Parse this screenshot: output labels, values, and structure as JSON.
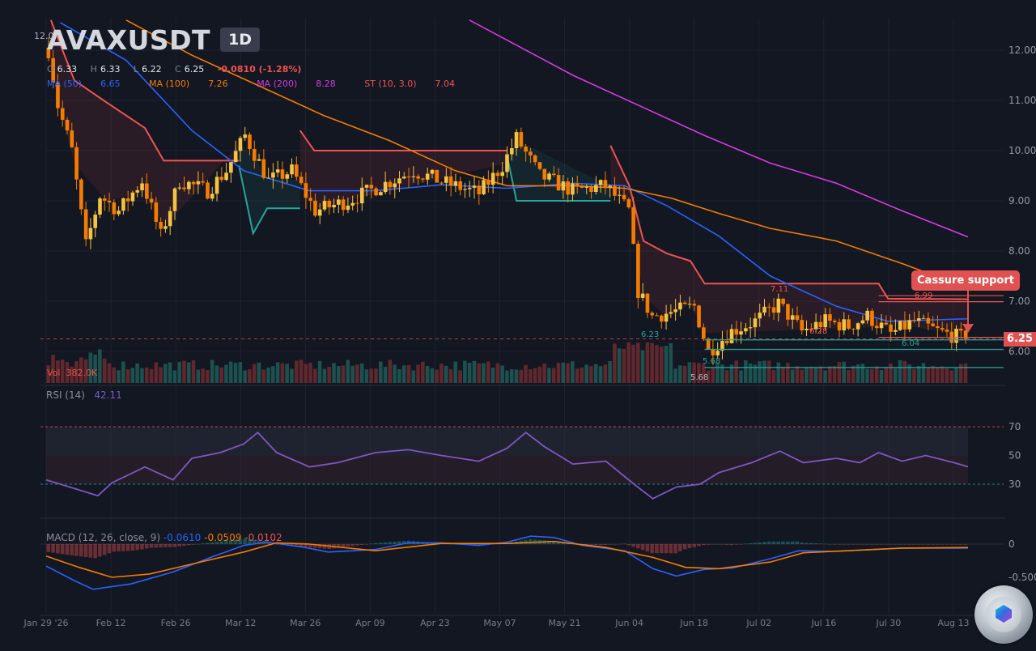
{
  "header": {
    "symbol": "AVAXUSDT",
    "timeframe": "1D",
    "ohlc": {
      "o_label": "O",
      "o": "6.33",
      "h_label": "H",
      "h": "6.33",
      "l_label": "L",
      "l": "6.22",
      "c_label": "C",
      "c": "6.25",
      "change": "-0.0810 (-1.28%)"
    },
    "mas": [
      {
        "label": "MA (50)",
        "value": "6.65",
        "color": "#2962ff"
      },
      {
        "label": "MA (100)",
        "value": "7.26",
        "color": "#f57c00"
      },
      {
        "label": "MA (200)",
        "value": "8.28",
        "color": "#d63ae0"
      },
      {
        "label": "ST (10, 3.0)",
        "value": "7.04",
        "color": "#ef5350"
      }
    ]
  },
  "callout": "Cassure support",
  "last_price_tag": "6.25",
  "top_left_tick": "12.0",
  "volume_label": "Vol",
  "volume_value": "382.0K",
  "rsi_label": "RSI (14)",
  "rsi_value": "42.11",
  "macd_label": "MACD (12, 26, close, 9)",
  "macd_values": [
    "-0.0610",
    "-0.0509",
    "-0.0102"
  ],
  "level_labels": [
    {
      "text": "7.11",
      "color": "#ef5350"
    },
    {
      "text": "6.99",
      "color": "#ef5350"
    },
    {
      "text": "6.28",
      "color": "#ef5350"
    },
    {
      "text": "6.23",
      "color": "#26a69a"
    },
    {
      "text": "6.04",
      "color": "#26a69a"
    },
    {
      "text": "5.68",
      "color": "#26a69a"
    },
    {
      "text": "5.68",
      "color": "#b0b3bf"
    }
  ],
  "colors": {
    "background": "#131722",
    "grid": "#1e2230",
    "bull": "#f5c242",
    "bear": "#f57c00",
    "vol_up": "#1f5c57",
    "vol_down": "#6e2a2f",
    "ma50": "#2962ff",
    "ma100": "#f57c00",
    "ma200": "#d63ae0",
    "supertrend_bear": "#ef5350",
    "supertrend_bull": "#26a69a",
    "rsi": "#7e57c2",
    "macd": "#2962ff",
    "signal": "#f57c00"
  },
  "chart_data": {
    "type": "candlestick",
    "x_axis": {
      "range": [
        "2026-01-29",
        "2026-08-16"
      ],
      "tick_labels": [
        "Jan 29 '26",
        "Feb 12",
        "Feb 26",
        "Mar 12",
        "Mar 26",
        "Apr 09",
        "Apr 23",
        "May 07",
        "May 21",
        "Jun 04",
        "Jun 18",
        "Jul 02",
        "Jul 16",
        "Jul 30",
        "Aug 13"
      ]
    },
    "price_axis": {
      "ylim": [
        5.5,
        12.6
      ],
      "ticks": [
        "12.00",
        "11.00",
        "10.00",
        "9.00",
        "8.00",
        "7.00",
        "6.00"
      ],
      "grid": true
    },
    "last_close": 6.25,
    "price_path": [
      {
        "date": "2026-01-29",
        "close": 12.0
      },
      {
        "date": "2026-01-31",
        "close": 10.9
      },
      {
        "date": "2026-02-03",
        "close": 10.0
      },
      {
        "date": "2026-02-06",
        "close": 8.1
      },
      {
        "date": "2026-02-09",
        "close": 9.1
      },
      {
        "date": "2026-02-13",
        "close": 8.8
      },
      {
        "date": "2026-02-18",
        "close": 9.4
      },
      {
        "date": "2026-02-22",
        "close": 8.3
      },
      {
        "date": "2026-02-26",
        "close": 9.4
      },
      {
        "date": "2026-03-04",
        "close": 9.2
      },
      {
        "date": "2026-03-08",
        "close": 9.6
      },
      {
        "date": "2026-03-12",
        "close": 10.3
      },
      {
        "date": "2026-03-17",
        "close": 9.4
      },
      {
        "date": "2026-03-22",
        "close": 9.6
      },
      {
        "date": "2026-03-27",
        "close": 8.8
      },
      {
        "date": "2026-04-03",
        "close": 9.0
      },
      {
        "date": "2026-04-10",
        "close": 9.3
      },
      {
        "date": "2026-04-17",
        "close": 9.6
      },
      {
        "date": "2026-04-24",
        "close": 9.35
      },
      {
        "date": "2026-05-01",
        "close": 9.15
      },
      {
        "date": "2026-05-06",
        "close": 9.7
      },
      {
        "date": "2026-05-09",
        "close": 10.25
      },
      {
        "date": "2026-05-14",
        "close": 9.5
      },
      {
        "date": "2026-05-21",
        "close": 9.2
      },
      {
        "date": "2026-05-28",
        "close": 9.3
      },
      {
        "date": "2026-06-02",
        "close": 8.8
      },
      {
        "date": "2026-06-04",
        "close": 7.2
      },
      {
        "date": "2026-06-07",
        "close": 6.7
      },
      {
        "date": "2026-06-12",
        "close": 6.8
      },
      {
        "date": "2026-06-16",
        "close": 6.9
      },
      {
        "date": "2026-06-19",
        "close": 6.0
      },
      {
        "date": "2026-06-24",
        "close": 6.4
      },
      {
        "date": "2026-06-29",
        "close": 6.6
      },
      {
        "date": "2026-07-04",
        "close": 6.95
      },
      {
        "date": "2026-07-09",
        "close": 6.4
      },
      {
        "date": "2026-07-14",
        "close": 6.6
      },
      {
        "date": "2026-07-19",
        "close": 6.5
      },
      {
        "date": "2026-07-23",
        "close": 6.7
      },
      {
        "date": "2026-07-28",
        "close": 6.35
      },
      {
        "date": "2026-08-02",
        "close": 6.6
      },
      {
        "date": "2026-08-07",
        "close": 6.4
      },
      {
        "date": "2026-08-13",
        "close": 6.25
      }
    ],
    "series": [
      {
        "name": "MA (50)",
        "points": [
          [
            "2026-02-01",
            12.55
          ],
          [
            "2026-02-15",
            11.8
          ],
          [
            "2026-03-01",
            10.4
          ],
          [
            "2026-03-12",
            9.6
          ],
          [
            "2026-03-26",
            9.2
          ],
          [
            "2026-04-09",
            9.2
          ],
          [
            "2026-04-23",
            9.32
          ],
          [
            "2026-05-07",
            9.25
          ],
          [
            "2026-05-21",
            9.35
          ],
          [
            "2026-06-01",
            9.3
          ],
          [
            "2026-06-10",
            8.9
          ],
          [
            "2026-06-21",
            8.3
          ],
          [
            "2026-07-02",
            7.5
          ],
          [
            "2026-07-16",
            6.9
          ],
          [
            "2026-07-27",
            6.6
          ],
          [
            "2026-08-13",
            6.65
          ]
        ]
      },
      {
        "name": "MA (100)",
        "points": [
          [
            "2026-02-15",
            12.6
          ],
          [
            "2026-03-01",
            11.9
          ],
          [
            "2026-03-15",
            11.3
          ],
          [
            "2026-03-29",
            10.7
          ],
          [
            "2026-04-12",
            10.2
          ],
          [
            "2026-04-26",
            9.6
          ],
          [
            "2026-05-07",
            9.3
          ],
          [
            "2026-05-21",
            9.3
          ],
          [
            "2026-06-01",
            9.25
          ],
          [
            "2026-06-11",
            9.05
          ],
          [
            "2026-06-21",
            8.75
          ],
          [
            "2026-07-02",
            8.45
          ],
          [
            "2026-07-16",
            8.2
          ],
          [
            "2026-07-30",
            7.75
          ],
          [
            "2026-08-13",
            7.26
          ]
        ]
      },
      {
        "name": "MA (200)",
        "points": [
          [
            "2026-04-29",
            12.6
          ],
          [
            "2026-05-07",
            12.2
          ],
          [
            "2026-05-21",
            11.5
          ],
          [
            "2026-06-04",
            10.9
          ],
          [
            "2026-06-18",
            10.3
          ],
          [
            "2026-07-02",
            9.75
          ],
          [
            "2026-07-16",
            9.35
          ],
          [
            "2026-07-30",
            8.8
          ],
          [
            "2026-08-13",
            8.28
          ]
        ]
      },
      {
        "name": "ST (10, 3.0)",
        "segments": [
          {
            "trend": "down",
            "points": [
              [
                "2026-01-30",
                12.6
              ],
              [
                "2026-02-04",
                11.4
              ],
              [
                "2026-02-11",
                10.95
              ],
              [
                "2026-02-19",
                10.45
              ],
              [
                "2026-02-23",
                9.8
              ],
              [
                "2026-03-11",
                9.8
              ]
            ]
          },
          {
            "trend": "up",
            "points": [
              [
                "2026-03-11",
                9.7
              ],
              [
                "2026-03-14",
                8.35
              ],
              [
                "2026-03-17",
                8.85
              ],
              [
                "2026-03-24",
                8.85
              ]
            ]
          },
          {
            "trend": "down",
            "points": [
              [
                "2026-03-24",
                10.4
              ],
              [
                "2026-03-27",
                10.0
              ],
              [
                "2026-05-07",
                10.0
              ]
            ]
          },
          {
            "trend": "up",
            "points": [
              [
                "2026-05-07",
                9.9
              ],
              [
                "2026-05-09",
                9.0
              ],
              [
                "2026-05-29",
                9.0
              ]
            ]
          },
          {
            "trend": "down",
            "points": [
              [
                "2026-05-29",
                10.1
              ],
              [
                "2026-06-02",
                9.3
              ],
              [
                "2026-06-05",
                8.2
              ],
              [
                "2026-06-10",
                7.95
              ],
              [
                "2026-06-15",
                7.8
              ],
              [
                "2026-06-18",
                7.35
              ],
              [
                "2026-07-25",
                7.35
              ],
              [
                "2026-07-27",
                7.05
              ],
              [
                "2026-08-13",
                7.04
              ]
            ]
          }
        ]
      }
    ],
    "volume": {
      "last": "382.0K",
      "pattern": "spike near Jun 04 and late May; elevated in late Jan/early Feb"
    },
    "rsi": {
      "name": "RSI (14)",
      "period": 14,
      "last": 42.11,
      "levels": [
        70,
        50,
        30
      ],
      "ylim": [
        10,
        90
      ],
      "points": [
        [
          "2026-01-29",
          33
        ],
        [
          "2026-02-03",
          28
        ],
        [
          "2026-02-09",
          22
        ],
        [
          "2026-02-12",
          31
        ],
        [
          "2026-02-19",
          42
        ],
        [
          "2026-02-25",
          33
        ],
        [
          "2026-03-01",
          48
        ],
        [
          "2026-03-07",
          52
        ],
        [
          "2026-03-12",
          58
        ],
        [
          "2026-03-15",
          66
        ],
        [
          "2026-03-19",
          52
        ],
        [
          "2026-03-26",
          42
        ],
        [
          "2026-04-01",
          45
        ],
        [
          "2026-04-09",
          52
        ],
        [
          "2026-04-16",
          54
        ],
        [
          "2026-04-23",
          50
        ],
        [
          "2026-05-01",
          46
        ],
        [
          "2026-05-07",
          55
        ],
        [
          "2026-05-11",
          66
        ],
        [
          "2026-05-15",
          56
        ],
        [
          "2026-05-21",
          44
        ],
        [
          "2026-05-28",
          46
        ],
        [
          "2026-06-03",
          30
        ],
        [
          "2026-06-07",
          20
        ],
        [
          "2026-06-12",
          28
        ],
        [
          "2026-06-17",
          30
        ],
        [
          "2026-06-21",
          38
        ],
        [
          "2026-06-28",
          45
        ],
        [
          "2026-07-04",
          53
        ],
        [
          "2026-07-09",
          45
        ],
        [
          "2026-07-16",
          48
        ],
        [
          "2026-07-21",
          45
        ],
        [
          "2026-07-25",
          52
        ],
        [
          "2026-07-30",
          46
        ],
        [
          "2026-08-04",
          50
        ],
        [
          "2026-08-10",
          45
        ],
        [
          "2026-08-13",
          42.11
        ]
      ]
    },
    "macd": {
      "name": "MACD (12, 26, close, 9)",
      "macd_last": -0.061,
      "signal_last": -0.0509,
      "hist_last": -0.0102,
      "ylim": [
        -0.75,
        0.25
      ],
      "ticks": [
        "0",
        "-0.500"
      ],
      "macd_points": [
        [
          "2026-01-29",
          -0.33
        ],
        [
          "2026-02-04",
          -0.55
        ],
        [
          "2026-02-08",
          -0.68
        ],
        [
          "2026-02-16",
          -0.6
        ],
        [
          "2026-02-25",
          -0.42
        ],
        [
          "2026-03-05",
          -0.2
        ],
        [
          "2026-03-12",
          -0.02
        ],
        [
          "2026-03-17",
          0.03
        ],
        [
          "2026-03-25",
          -0.05
        ],
        [
          "2026-03-30",
          -0.12
        ],
        [
          "2026-04-09",
          -0.08
        ],
        [
          "2026-04-16",
          0.02
        ],
        [
          "2026-04-23",
          0.02
        ],
        [
          "2026-05-01",
          -0.02
        ],
        [
          "2026-05-07",
          0.03
        ],
        [
          "2026-05-12",
          0.12
        ],
        [
          "2026-05-17",
          0.1
        ],
        [
          "2026-05-23",
          -0.02
        ],
        [
          "2026-06-01",
          -0.1
        ],
        [
          "2026-06-07",
          -0.37
        ],
        [
          "2026-06-12",
          -0.48
        ],
        [
          "2026-06-18",
          -0.38
        ],
        [
          "2026-06-24",
          -0.36
        ],
        [
          "2026-07-02",
          -0.22
        ],
        [
          "2026-07-08",
          -0.1
        ],
        [
          "2026-07-16",
          -0.11
        ],
        [
          "2026-07-30",
          -0.06
        ],
        [
          "2026-08-13",
          -0.061
        ]
      ],
      "signal_points": [
        [
          "2026-01-29",
          -0.18
        ],
        [
          "2026-02-05",
          -0.35
        ],
        [
          "2026-02-12",
          -0.5
        ],
        [
          "2026-02-20",
          -0.45
        ],
        [
          "2026-03-01",
          -0.3
        ],
        [
          "2026-03-12",
          -0.12
        ],
        [
          "2026-03-19",
          0.02
        ],
        [
          "2026-03-26",
          0.0
        ],
        [
          "2026-04-09",
          -0.1
        ],
        [
          "2026-04-23",
          0.01
        ],
        [
          "2026-05-07",
          0.01
        ],
        [
          "2026-05-17",
          0.04
        ],
        [
          "2026-05-28",
          -0.05
        ],
        [
          "2026-06-07",
          -0.2
        ],
        [
          "2026-06-14",
          -0.35
        ],
        [
          "2026-06-21",
          -0.37
        ],
        [
          "2026-07-02",
          -0.27
        ],
        [
          "2026-07-09",
          -0.13
        ],
        [
          "2026-07-30",
          -0.06
        ],
        [
          "2026-08-13",
          -0.0509
        ]
      ]
    }
  }
}
